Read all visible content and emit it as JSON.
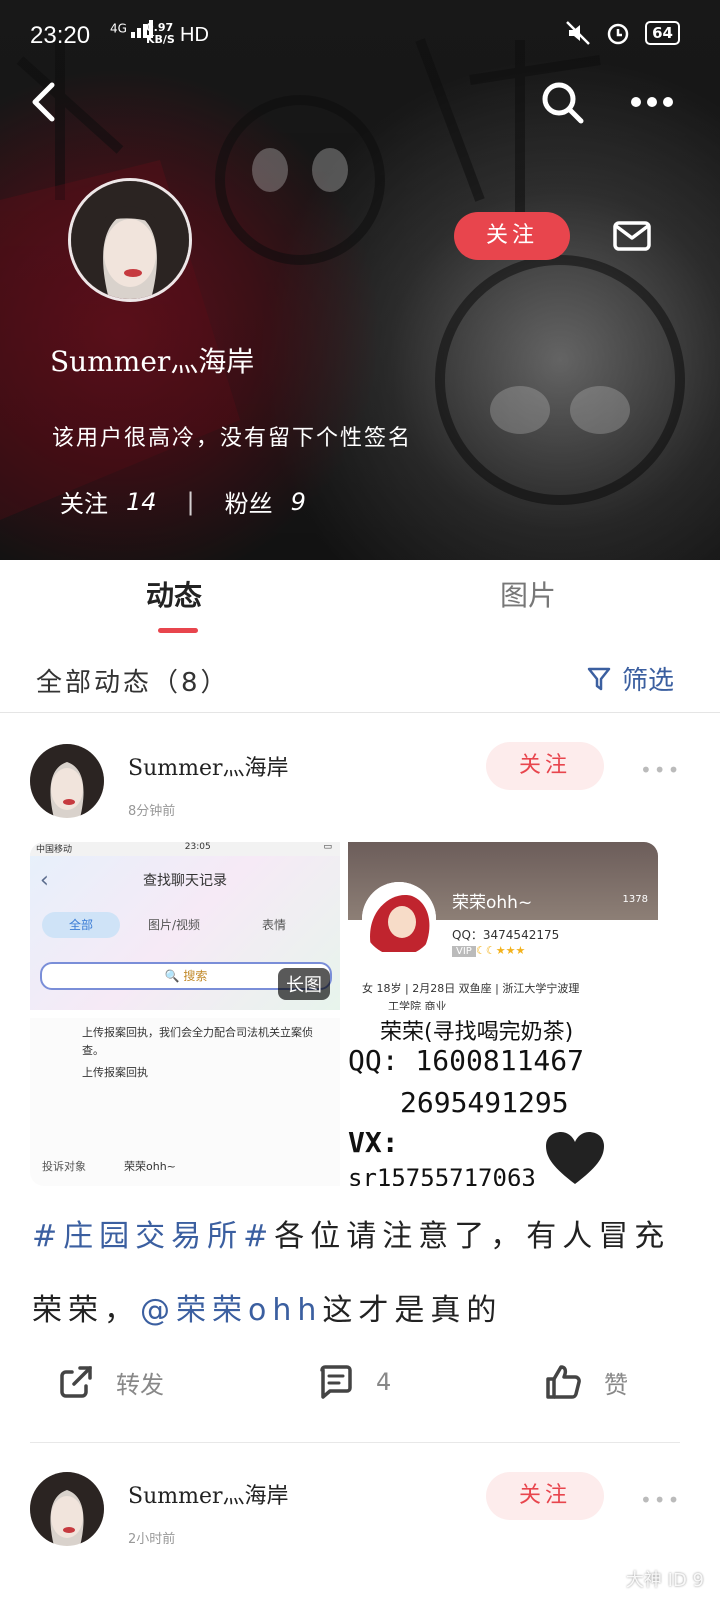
{
  "status_bar": {
    "time": "23:20",
    "network": "4G",
    "speed": "0.97\nKB/S",
    "hd": "HD",
    "battery": "64"
  },
  "profile": {
    "name": "Summer灬海岸",
    "signature": "该用户很高冷，没有留下个性签名",
    "following_label": "关注",
    "following_count": "14",
    "fans_label": "粉丝",
    "fans_count": "9",
    "follow_button": "关注"
  },
  "tabs": [
    {
      "label": "动态",
      "active": true
    },
    {
      "label": "图片",
      "active": false
    }
  ],
  "filter": {
    "title": "全部动态（8）",
    "button": "筛选"
  },
  "posts": [
    {
      "author": "Summer灬海岸",
      "time": "8分钟前",
      "follow_label": "关注",
      "long_image_badge": "长图",
      "images": {
        "img1": {
          "carrier": "中国移动",
          "clock": "23:05",
          "search_title": "查找聊天记录",
          "tabs": [
            "全部",
            "图片/视频",
            "表情"
          ],
          "search_btn": "搜索"
        },
        "img2": {
          "name": "荣荣ohh~",
          "qq": "QQ：3474542175",
          "vip": "VIP",
          "info": "女  18岁  |  2月28日  双鱼座  |  浙江大学宁波理",
          "info2": "工学院  商业",
          "likes": "1378"
        },
        "img3": {
          "line1": "上传报案回执，我们会全力配合司法机关立案侦查。",
          "line2": "上传报案回执",
          "footer_left": "投诉对象",
          "footer_right": "荣荣ohh~"
        },
        "img4": {
          "line1": "荣荣(寻找喝完奶茶)",
          "line2": "QQ: 1600811467",
          "line3": "2695491295",
          "line4": "VX:",
          "line5": "sr15755717063"
        }
      },
      "text_tag": "#庄园交易所#",
      "text_main": "各位请注意了，有人冒充荣荣，",
      "text_mention": "@荣荣ohh",
      "text_end": "这才是真的",
      "actions": {
        "repost": "转发",
        "comments": "4",
        "like": "赞"
      }
    },
    {
      "author": "Summer灬海岸",
      "time": "2小时前",
      "follow_label": "关注"
    }
  ],
  "watermark": "大神 ID 9"
}
